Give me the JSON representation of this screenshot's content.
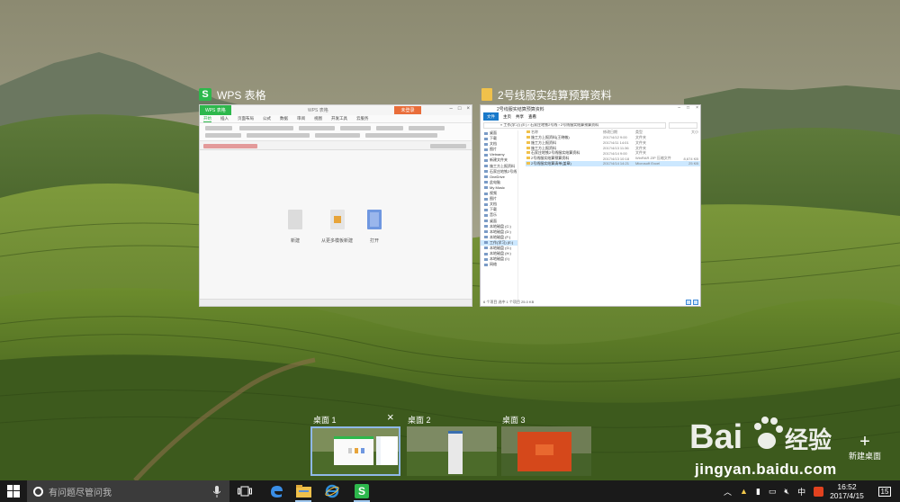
{
  "windows": {
    "wps": {
      "title": "WPS 表格",
      "app_tab": "WPS 表格",
      "doc_title": "WPS 表格",
      "login": "未登录",
      "menu": [
        "开始",
        "插入",
        "页面布局",
        "公式",
        "数据",
        "审阅",
        "视图",
        "开发工具",
        "云服务"
      ],
      "cards": [
        {
          "label": "新建"
        },
        {
          "label": "从更多模板新建"
        },
        {
          "label": "打开"
        }
      ]
    },
    "explorer": {
      "title": "2号线服实结算预算资料",
      "menu": [
        "文件",
        "主页",
        "共享",
        "查看"
      ],
      "path": "« 工作(学习) (E:) › 石家庄地铁2号线 › 2号线服实结算预算资料",
      "columns": [
        "名称",
        "修改日期",
        "类型",
        "大小"
      ],
      "files": [
        {
          "name": "施工方上报资料(王晓敏)",
          "date": "2017/4/12 9:00",
          "type": "文件夹",
          "size": ""
        },
        {
          "name": "施工方上报资料",
          "date": "2017/4/11 14:01",
          "type": "文件夹",
          "size": ""
        },
        {
          "name": "施工方上报资料",
          "date": "2017/4/13 11:36",
          "type": "文件夹",
          "size": ""
        },
        {
          "name": "石家庄地铁2号线服实结算资料",
          "date": "2017/4/14 9:00",
          "type": "文件夹",
          "size": ""
        },
        {
          "name": "2号线服实结算预算资料",
          "date": "2017/4/13 10:18",
          "type": "WinRAR ZIP 压缩文件",
          "size": "8,674 KB"
        },
        {
          "name": "2号线服实结算清单(盖章)",
          "date": "2017/4/14 14:21",
          "type": "Microsoft Excel",
          "size": "25 KB"
        }
      ],
      "sidebar": [
        "桌面",
        "下载",
        "文档",
        "图片",
        "Vietnamy",
        "新建文件夹",
        "施工方上报资料",
        "石家庄地铁2号线",
        "OneDrive",
        "此电脑",
        "My Music",
        "视频",
        "图片",
        "文档",
        "下载",
        "音乐",
        "桌面",
        "本地磁盘 (C:)",
        "本地磁盘 (D:)",
        "本地磁盘 (F:)",
        "工作(学习) (E:)",
        "本地磁盘 (G:)",
        "本地磁盘 (H:)",
        "本地磁盘 (I:)",
        "网络"
      ],
      "status": "6 个项目  选中 1 个项目  25.0 KB"
    }
  },
  "desktops": [
    {
      "label": "桌面 1"
    },
    {
      "label": "桌面 2"
    },
    {
      "label": "桌面 3"
    }
  ],
  "desktop_close": "×",
  "new_desktop": {
    "plus": "+",
    "label": "新建桌面"
  },
  "taskbar": {
    "search_placeholder": "有问题尽管问我",
    "ime_label": "中",
    "clock_time": "16:52",
    "clock_date": "2017/4/15",
    "notification_count": "15"
  },
  "watermark": {
    "brand": "Bai",
    "brand2": "经验",
    "url": "jingyan.baidu.com"
  },
  "colors": {
    "wps_green": "#2db84c",
    "explorer_blue": "#1979ca",
    "taskbar": "#1a1a1a"
  }
}
